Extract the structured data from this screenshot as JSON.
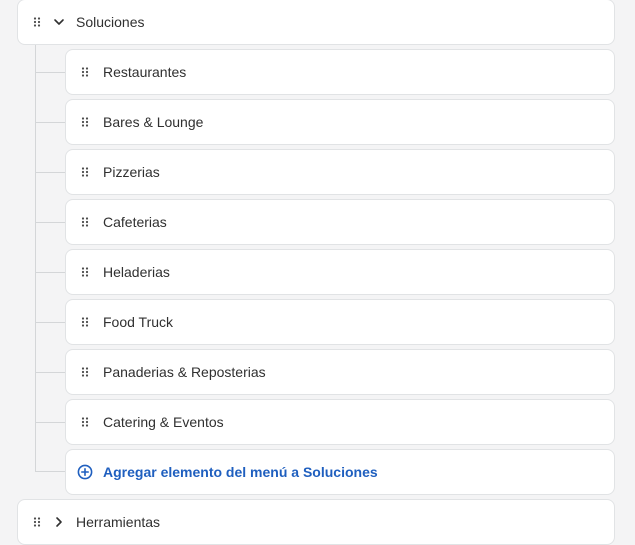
{
  "menu": {
    "parent_expanded": {
      "label": "Soluciones",
      "grip_icon": "drag-handle-icon",
      "toggle_icon": "chevron-down-icon"
    },
    "children": [
      {
        "label": "Restaurantes"
      },
      {
        "label": "Bares & Lounge"
      },
      {
        "label": "Pizzerias"
      },
      {
        "label": "Cafeterias"
      },
      {
        "label": "Heladerias"
      },
      {
        "label": "Food Truck"
      },
      {
        "label": "Panaderias & Reposterias"
      },
      {
        "label": "Catering & Eventos"
      }
    ],
    "add_item": {
      "label_prefix": "Agregar elemento del menú a ",
      "label_target": "Soluciones",
      "icon": "plus-circle-icon"
    },
    "parent_collapsed": {
      "label": "Herramientas",
      "toggle_icon": "chevron-right-icon"
    }
  },
  "colors": {
    "background": "#f4f4f5",
    "card": "#ffffff",
    "border": "#e1e3e5",
    "link": "#1f5fbf",
    "text": "#303030"
  }
}
